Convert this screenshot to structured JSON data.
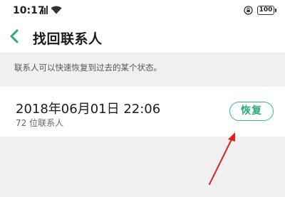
{
  "status_bar": {
    "time": "10:17",
    "battery": "100",
    "icons": [
      "signal-icon",
      "wifi-icon",
      "lock-rotation-icon",
      "battery-icon"
    ]
  },
  "header": {
    "title": "找回联系人",
    "back_icon": "chevron-left-icon"
  },
  "hint": {
    "text": "联系人可以快速恢复到过去的某个状态。"
  },
  "backup_item": {
    "date": "2018年06月01日 22:06",
    "count": "72 位联系人",
    "restore_label": "恢复"
  },
  "colors": {
    "accent": "#2aaa78",
    "annotation_arrow": "#e02020",
    "background": "#f0f0f0"
  }
}
